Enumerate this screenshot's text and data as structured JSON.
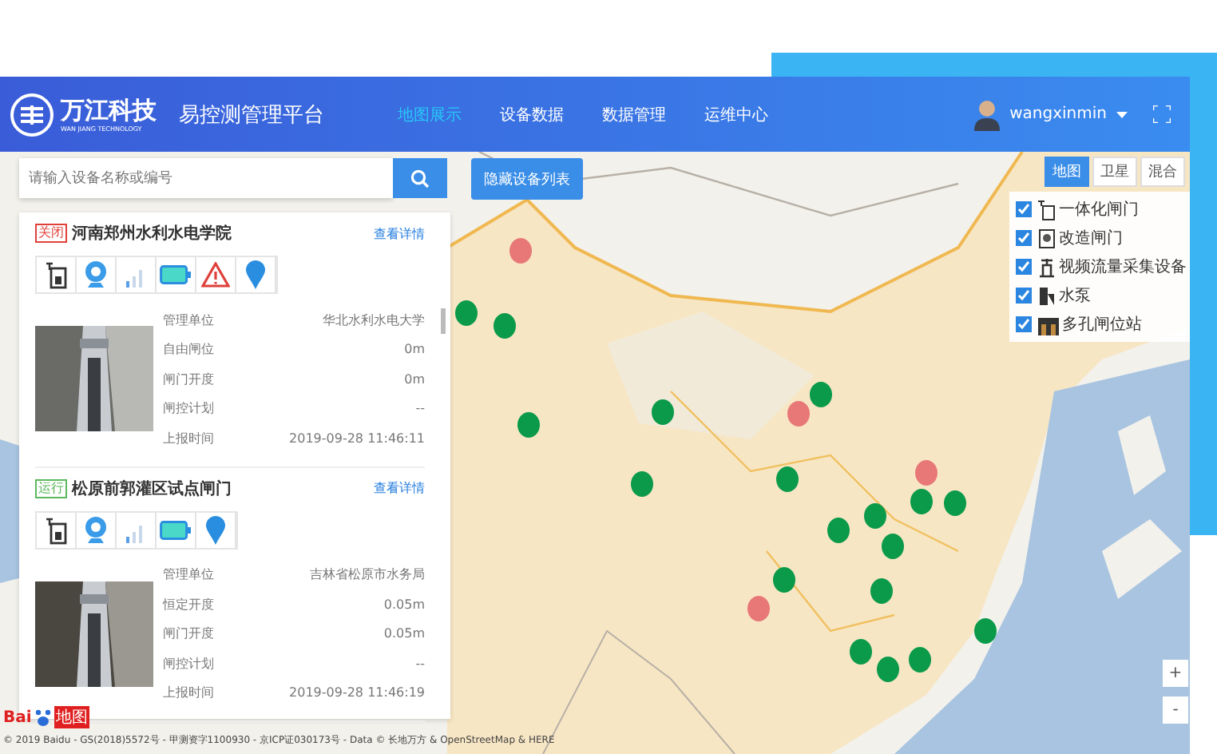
{
  "header": {
    "logo_name": "万江科技",
    "logo_sub": "WAN JIANG TECHNOLOGY",
    "title": "易控测管理平台",
    "nav": [
      {
        "label": "地图展示",
        "selected": true
      },
      {
        "label": "设备数据",
        "selected": false
      },
      {
        "label": "数据管理",
        "selected": false
      },
      {
        "label": "运维中心",
        "selected": false
      }
    ],
    "user": "wangxinmin"
  },
  "search": {
    "placeholder": "请输入设备名称或编号"
  },
  "toggle_button": "隐藏设备列表",
  "devices": [
    {
      "status": {
        "text": "关闭",
        "color": "#e0403a"
      },
      "name": "河南郑州水利水电学院",
      "link": "查看详情",
      "icons": [
        {
          "kind": "gate"
        },
        {
          "kind": "camera"
        },
        {
          "kind": "signal"
        },
        {
          "kind": "battery"
        },
        {
          "kind": "warning"
        },
        {
          "kind": "location"
        }
      ],
      "fields": [
        {
          "label": "管理单位",
          "value": "华北水利水电大学"
        },
        {
          "label": "自由闸位",
          "value": "0m"
        },
        {
          "label": "闸门开度",
          "value": "0m"
        },
        {
          "label": "闸控计划",
          "value": "--"
        },
        {
          "label": "上报时间",
          "value": "2019-09-28 11:46:11"
        }
      ]
    },
    {
      "status": {
        "text": "运行",
        "color": "#5cb85c"
      },
      "name": "松原前郭灌区试点闸门",
      "link": "查看详情",
      "icons": [
        {
          "kind": "gate"
        },
        {
          "kind": "camera"
        },
        {
          "kind": "signal"
        },
        {
          "kind": "battery"
        },
        {
          "kind": "location"
        }
      ],
      "fields": [
        {
          "label": "管理单位",
          "value": "吉林省松原市水务局"
        },
        {
          "label": "恒定开度",
          "value": "0.05m"
        },
        {
          "label": "闸门开度",
          "value": "0.05m"
        },
        {
          "label": "闸控计划",
          "value": "--"
        },
        {
          "label": "上报时间",
          "value": "2019-09-28 11:46:19"
        }
      ]
    }
  ],
  "map_types": [
    {
      "label": "地图",
      "selected": true
    },
    {
      "label": "卫星",
      "selected": false
    },
    {
      "label": "混合",
      "selected": false
    }
  ],
  "legend": [
    {
      "label": "一体化闸门",
      "checked": true,
      "kind": "gate"
    },
    {
      "label": "改造闸门",
      "checked": true,
      "kind": "retrofit"
    },
    {
      "label": "视频流量采集设备",
      "checked": true,
      "kind": "video"
    },
    {
      "label": "水泵",
      "checked": true,
      "kind": "pump"
    },
    {
      "label": "多孔闸位站",
      "checked": true,
      "kind": "station"
    }
  ],
  "zoom": [
    "+",
    "-"
  ],
  "markers": [
    {
      "color": "#e87878"
    },
    {
      "color": "#0a9a4a"
    },
    {
      "color": "#0a9a4a"
    },
    {
      "color": "#0a9a4a"
    },
    {
      "color": "#0a9a4a"
    },
    {
      "color": "#0a9a4a"
    },
    {
      "color": "#0a9a4a"
    },
    {
      "color": "#e87878"
    },
    {
      "color": "#0a9a4a"
    },
    {
      "color": "#e87878"
    },
    {
      "color": "#0a9a4a"
    },
    {
      "color": "#0a9a4a"
    },
    {
      "color": "#0a9a4a"
    },
    {
      "color": "#0a9a4a"
    },
    {
      "color": "#0a9a4a"
    },
    {
      "color": "#0a9a4a"
    },
    {
      "color": "#e87878"
    },
    {
      "color": "#0a9a4a"
    },
    {
      "color": "#0a9a4a"
    },
    {
      "color": "#0a9a4a"
    },
    {
      "color": "#0a9a4a"
    },
    {
      "color": "#0a9a4a"
    }
  ],
  "map_logo": "Bai",
  "map_logo_cn": "地图",
  "copyright": "© 2019 Baidu - GS(2018)5572号 - 甲测资字1100930 - 京ICP证030173号 - Data © 长地万方 & OpenStreetMap & HERE"
}
